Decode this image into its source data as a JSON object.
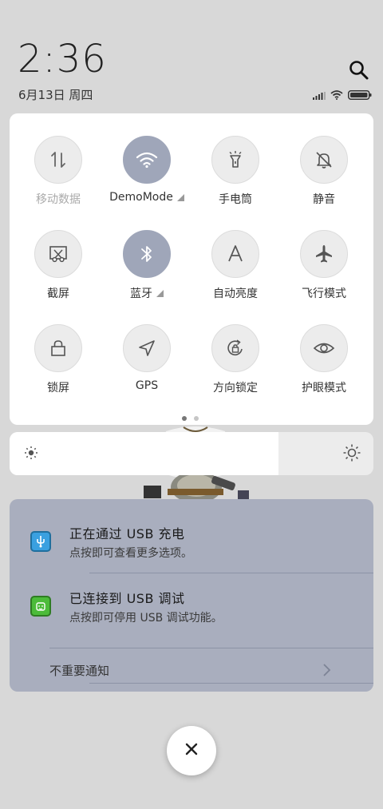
{
  "header": {
    "time": "2:36",
    "date": "6月13日 周四"
  },
  "icons": {
    "search": "search-icon",
    "signal": "cellular-signal-icon",
    "wifi": "wifi-status-icon",
    "battery": "battery-icon"
  },
  "quick_settings": {
    "tiles": [
      {
        "label": "移动数据",
        "icon": "mobile-data-icon",
        "active": false,
        "dimmed": true,
        "has_menu": false
      },
      {
        "label": "DemoMode",
        "icon": "wifi-icon",
        "active": true,
        "dimmed": false,
        "has_menu": true
      },
      {
        "label": "手电筒",
        "icon": "flashlight-icon",
        "active": false,
        "dimmed": false,
        "has_menu": false
      },
      {
        "label": "静音",
        "icon": "mute-bell-icon",
        "active": false,
        "dimmed": false,
        "has_menu": false
      },
      {
        "label": "截屏",
        "icon": "screenshot-icon",
        "active": false,
        "dimmed": false,
        "has_menu": false
      },
      {
        "label": "蓝牙",
        "icon": "bluetooth-icon",
        "active": true,
        "dimmed": false,
        "has_menu": true
      },
      {
        "label": "自动亮度",
        "icon": "auto-brightness-icon",
        "active": false,
        "dimmed": false,
        "has_menu": false
      },
      {
        "label": "飞行模式",
        "icon": "airplane-icon",
        "active": false,
        "dimmed": false,
        "has_menu": false
      },
      {
        "label": "锁屏",
        "icon": "lock-icon",
        "active": false,
        "dimmed": false,
        "has_menu": false
      },
      {
        "label": "GPS",
        "icon": "location-arrow-icon",
        "active": false,
        "dimmed": false,
        "has_menu": false
      },
      {
        "label": "方向锁定",
        "icon": "rotation-lock-icon",
        "active": false,
        "dimmed": false,
        "has_menu": false
      },
      {
        "label": "护眼模式",
        "icon": "eye-icon",
        "active": false,
        "dimmed": false,
        "has_menu": false
      }
    ],
    "page_count": 2,
    "current_page": 1
  },
  "brightness": {
    "level": 0.74
  },
  "notifications": [
    {
      "title": "正在通过 USB 充电",
      "subtitle": "点按即可查看更多选项。",
      "icon": "usb-icon",
      "icon_color": "#3aa0e0"
    },
    {
      "title": "已连接到 USB 调试",
      "subtitle": "点按即可停用 USB 调试功能。",
      "icon": "android-icon",
      "icon_color": "#4cbb3a"
    }
  ],
  "minor_notifications": {
    "label": "不重要通知"
  },
  "colors": {
    "background": "#d8d8d8",
    "panel": "#ffffff",
    "tile_active": "#9fa6b9",
    "notification_bg": "#a9aebe"
  }
}
